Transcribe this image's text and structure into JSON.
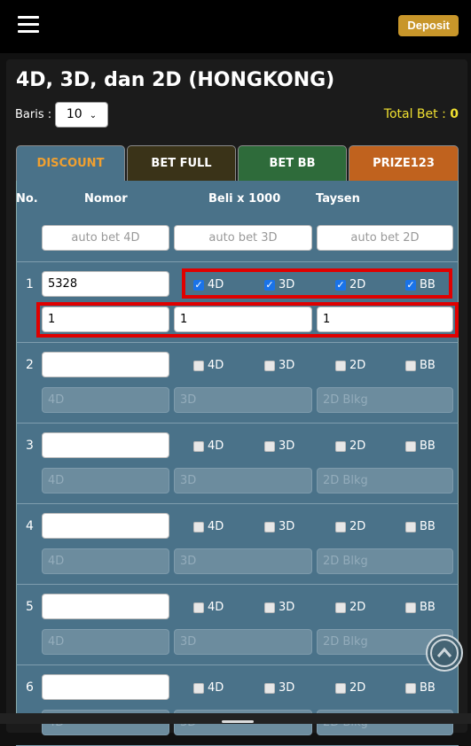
{
  "header": {
    "deposit_label": "Deposit"
  },
  "page": {
    "title": "4D, 3D, dan 2D (HONGKONG)",
    "baris_label": "Baris :",
    "baris_value": "10",
    "total_bet_label": "Total Bet :",
    "total_bet_value": "0"
  },
  "tabs": [
    {
      "label": "DISCOUNT",
      "bg": "#4a7289",
      "color": "#f0a030",
      "active": true
    },
    {
      "label": "BET FULL",
      "bg": "#3a3318",
      "color": "#ffffff",
      "active": false
    },
    {
      "label": "BET BB",
      "bg": "#2e6b3a",
      "color": "#ffffff",
      "active": false
    },
    {
      "label": "PRIZE123",
      "bg": "#c0621e",
      "color": "#ffffff",
      "active": false
    }
  ],
  "table": {
    "headers": {
      "no": "No.",
      "nomor": "Nomor",
      "beli": "Beli x 1000",
      "taysen": "Taysen"
    },
    "auto": {
      "bet4d": "auto bet 4D",
      "bet3d": "auto bet 3D",
      "bet2d": "auto bet 2D"
    },
    "checkbox_labels": {
      "c4d": "4D",
      "c3d": "3D",
      "c2d": "2D",
      "bb": "BB"
    },
    "placeholders": {
      "p4d": "4D",
      "p3d": "3D",
      "p2d": "2D Blkg"
    },
    "rows": [
      {
        "no": "1",
        "nomor": "5328",
        "checked": true,
        "v4d": "1",
        "v3d": "1",
        "v2d": "1"
      },
      {
        "no": "2",
        "nomor": "",
        "checked": false
      },
      {
        "no": "3",
        "nomor": "",
        "checked": false
      },
      {
        "no": "4",
        "nomor": "",
        "checked": false
      },
      {
        "no": "5",
        "nomor": "",
        "checked": false
      },
      {
        "no": "6",
        "nomor": "",
        "checked": false
      }
    ]
  },
  "colors": {
    "highlight": "#e00000",
    "accent": "#c8962a",
    "content_bg": "#4a7289"
  }
}
